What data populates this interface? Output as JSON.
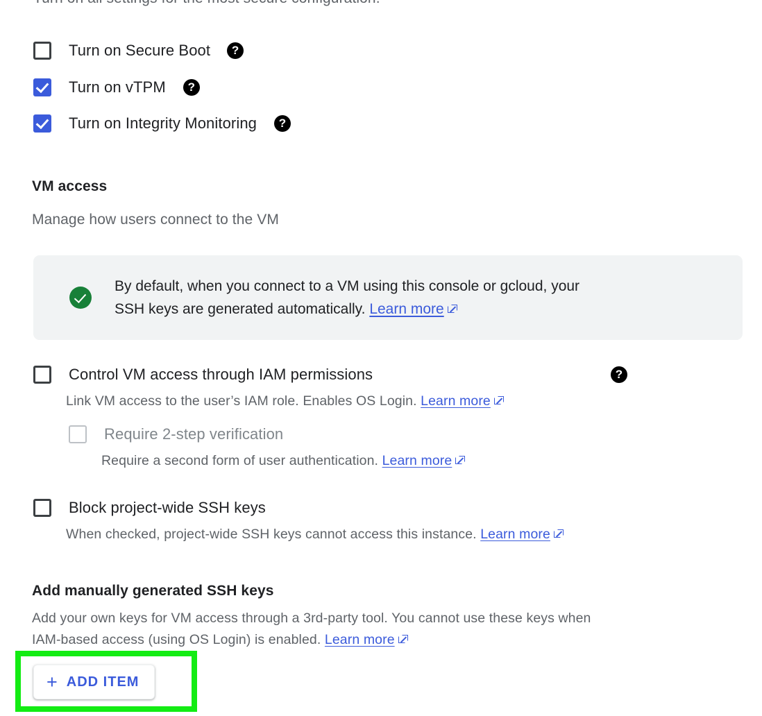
{
  "intro": {
    "text": "Turn on all settings for the most secure configuration."
  },
  "shielded_vm": {
    "options": [
      {
        "label": "Turn on Secure Boot",
        "checked": false,
        "help_icon": "help-icon"
      },
      {
        "label": "Turn on vTPM",
        "checked": true,
        "help_icon": "help-icon"
      },
      {
        "label": "Turn on Integrity Monitoring",
        "checked": true,
        "help_icon": "help-icon"
      }
    ]
  },
  "vm_access": {
    "title": "VM access",
    "subtitle": "Manage how users connect to the VM",
    "info_box": {
      "icon": "check-circle-icon",
      "text_line1": "By default, when you connect to a VM using this console or gcloud, your",
      "text_line2": "SSH keys are generated automatically.",
      "link_label": "Learn more",
      "link_icon": "external-link-icon"
    },
    "iam_option": {
      "label": "Control VM access through IAM permissions",
      "checked": false,
      "help_icon": "help-icon",
      "description": "Link VM access to the user’s IAM role. Enables OS Login.",
      "link_label": "Learn more"
    },
    "two_step_option": {
      "label": "Require 2-step verification",
      "checked": false,
      "disabled": true,
      "description": "Require a second form of user authentication.",
      "link_label": "Learn more"
    },
    "block_keys_option": {
      "label": "Block project-wide SSH keys",
      "checked": false,
      "description": "When checked, project-wide SSH keys cannot access this instance.",
      "link_label": "Learn more"
    }
  },
  "ssh_keys": {
    "title": "Add manually generated SSH keys",
    "description_line1": "Add your own keys for VM access through a 3rd-party tool. You cannot use these keys when",
    "description_line2": "IAM-based access (using OS Login) is enabled.",
    "link_label": "Learn more",
    "add_button": {
      "plus": "+",
      "label": "ADD ITEM"
    }
  },
  "colors": {
    "accent_blue": "#3b5bdb",
    "link_blue": "#3b5bdb",
    "success_green": "#188038",
    "highlight_green": "#13ec13",
    "info_bg": "#f1f3f4",
    "text_primary": "#202124",
    "text_secondary": "#5f6368",
    "text_disabled": "#80868b"
  }
}
